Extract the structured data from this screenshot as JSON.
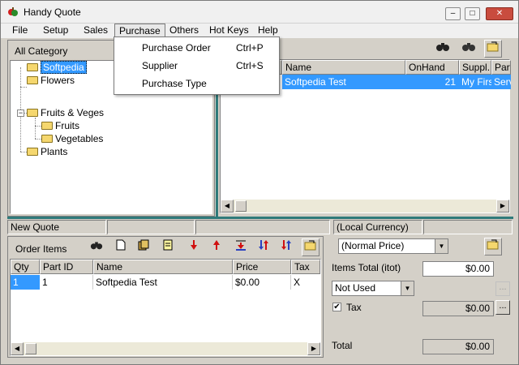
{
  "window": {
    "title": "Handy Quote",
    "min": "–",
    "max": "□",
    "close": "✕"
  },
  "menu": [
    "File",
    "Setup",
    "Sales",
    "Purchase",
    "Others",
    "Hot Keys",
    "Help"
  ],
  "purchase_menu": [
    {
      "label": "Purchase Order",
      "shortcut": "Ctrl+P"
    },
    {
      "label": "Supplier",
      "shortcut": "Ctrl+S"
    },
    {
      "label": "Purchase Type",
      "shortcut": ""
    }
  ],
  "category": {
    "header": "All Category",
    "nodes": [
      "Softpedia",
      "Flowers",
      "Fruits & Veges",
      "Fruits",
      "Vegetables",
      "Plants"
    ]
  },
  "parts_table": {
    "headers": [
      "",
      "Name",
      "OnHand",
      "Suppl...",
      "Part"
    ],
    "row": [
      "",
      "Softpedia Test",
      "21",
      "My First",
      "Serv"
    ]
  },
  "quote": {
    "status": [
      "New Quote",
      "",
      "",
      "(Local Currency)",
      ""
    ],
    "toolbar_label": "Order Items",
    "headers": [
      "Qty",
      "Part ID",
      "Name",
      "Price",
      "Tax"
    ],
    "row": [
      "1",
      "1",
      "Softpedia Test",
      "$0.00",
      "X"
    ]
  },
  "totals": {
    "price_mode": "(Normal Price)",
    "items_total_label": "Items Total (itot)",
    "items_total": "$0.00",
    "discount_mode": "Not Used",
    "tax_label": "Tax",
    "tax_checked": "✔",
    "tax_value": "$0.00",
    "total_label": "Total",
    "total_value": "$0.00",
    "ellipsis": "..."
  },
  "colors": {
    "selection": "#3399ff",
    "accent_border": "#2f7a7a"
  }
}
